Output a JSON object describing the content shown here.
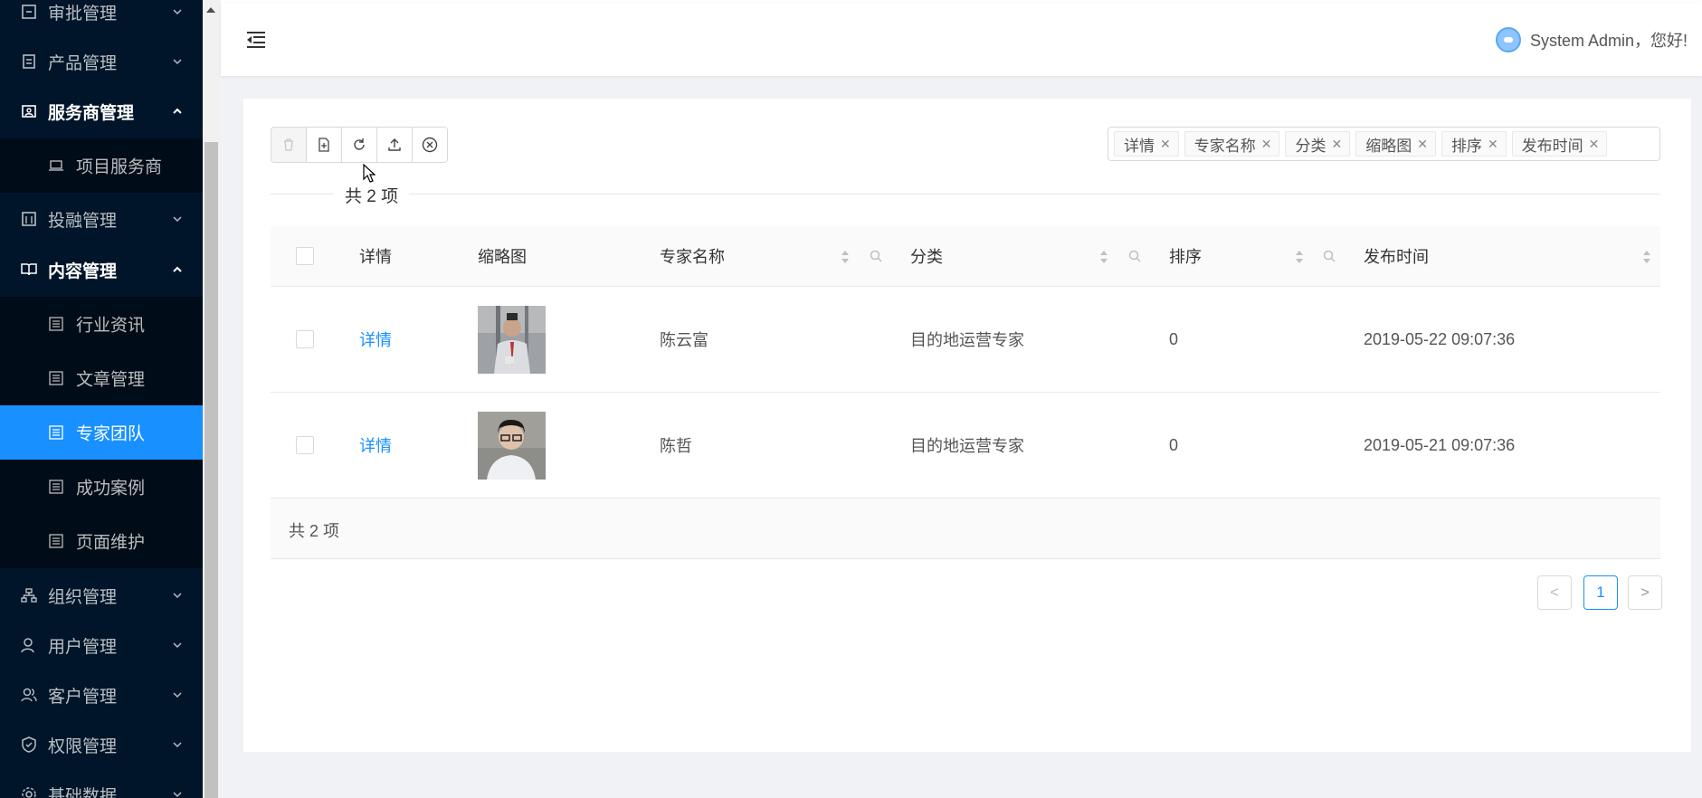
{
  "sidebar": {
    "items": [
      {
        "label": "审批管理",
        "icon": "approval-icon"
      },
      {
        "label": "产品管理",
        "icon": "product-icon"
      },
      {
        "label": "服务商管理",
        "icon": "provider-icon"
      },
      {
        "label": "投融管理",
        "icon": "investment-icon"
      },
      {
        "label": "内容管理",
        "icon": "content-icon"
      },
      {
        "label": "组织管理",
        "icon": "org-icon"
      },
      {
        "label": "用户管理",
        "icon": "user-icon"
      },
      {
        "label": "客户管理",
        "icon": "customer-icon"
      },
      {
        "label": "权限管理",
        "icon": "permission-icon"
      },
      {
        "label": "基础数据",
        "icon": "settings-icon"
      }
    ],
    "provider_sub": [
      {
        "label": "项目服务商"
      }
    ],
    "content_sub": [
      {
        "label": "行业资讯"
      },
      {
        "label": "文章管理"
      },
      {
        "label": "专家团队"
      },
      {
        "label": "成功案例"
      },
      {
        "label": "页面维护"
      }
    ],
    "active_color": "#1890ff"
  },
  "header": {
    "user_greeting": "System Admin，您好!"
  },
  "tags": [
    {
      "label": "详情"
    },
    {
      "label": "专家名称"
    },
    {
      "label": "分类"
    },
    {
      "label": "缩略图"
    },
    {
      "label": "排序"
    },
    {
      "label": "发布时间"
    }
  ],
  "summary": {
    "total_text": "共 2 项",
    "footer_text": "共 2 项"
  },
  "table": {
    "columns": [
      "详情",
      "缩略图",
      "专家名称",
      "分类",
      "排序",
      "发布时间"
    ],
    "rows": [
      {
        "detail": "详情",
        "name": "陈云富",
        "category": "目的地运营专家",
        "sort": "0",
        "published": "2019-05-22 09:07:36"
      },
      {
        "detail": "详情",
        "name": "陈哲",
        "category": "目的地运营专家",
        "sort": "0",
        "published": "2019-05-21 09:07:36"
      }
    ]
  },
  "pagination": {
    "current": "1",
    "prev": "<",
    "next": ">"
  }
}
